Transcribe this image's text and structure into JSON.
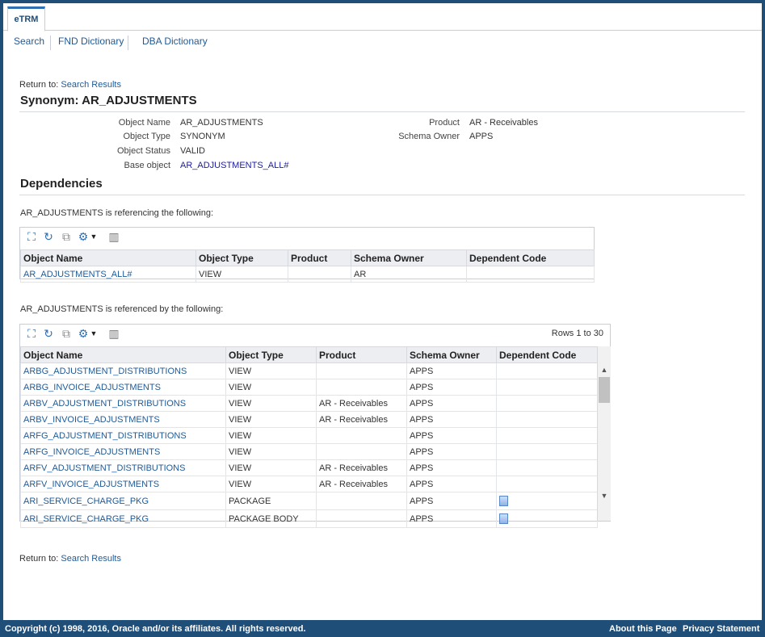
{
  "tabs": [
    {
      "label": "eTRM"
    }
  ],
  "subnav": [
    {
      "label": "Search"
    },
    {
      "label": "FND Dictionary"
    },
    {
      "label": "DBA Dictionary"
    }
  ],
  "return_to": {
    "prefix": "Return to:",
    "link": "Search Results"
  },
  "page_title": "Synonym: AR_ADJUSTMENTS",
  "details": {
    "object_name": {
      "label": "Object Name",
      "value": "AR_ADJUSTMENTS"
    },
    "object_type": {
      "label": "Object Type",
      "value": "SYNONYM"
    },
    "object_status": {
      "label": "Object Status",
      "value": "VALID"
    },
    "base_object": {
      "label": "Base object",
      "value": "AR_ADJUSTMENTS_ALL#"
    },
    "product": {
      "label": "Product",
      "value": "AR - Receivables"
    },
    "schema_owner": {
      "label": "Schema Owner",
      "value": "APPS"
    }
  },
  "dependencies_heading": "Dependencies",
  "referencing": {
    "caption": "AR_ADJUSTMENTS is referencing the following:",
    "columns": [
      "Object Name",
      "Object Type",
      "Product",
      "Schema Owner",
      "Dependent Code"
    ],
    "rows": [
      {
        "name": "AR_ADJUSTMENTS_ALL#",
        "type": "VIEW",
        "product": "",
        "owner": "AR"
      }
    ]
  },
  "referenced_by": {
    "caption": "AR_ADJUSTMENTS is referenced by the following:",
    "rows_label": "Rows 1 to 30",
    "columns": [
      "Object Name",
      "Object Type",
      "Product",
      "Schema Owner",
      "Dependent Code"
    ],
    "rows": [
      {
        "name": "ARBG_ADJUSTMENT_DISTRIBUTIONS",
        "type": "VIEW",
        "product": "",
        "owner": "APPS",
        "code": false
      },
      {
        "name": "ARBG_INVOICE_ADJUSTMENTS",
        "type": "VIEW",
        "product": "",
        "owner": "APPS",
        "code": false
      },
      {
        "name": "ARBV_ADJUSTMENT_DISTRIBUTIONS",
        "type": "VIEW",
        "product": "AR - Receivables",
        "owner": "APPS",
        "code": false
      },
      {
        "name": "ARBV_INVOICE_ADJUSTMENTS",
        "type": "VIEW",
        "product": "AR - Receivables",
        "owner": "APPS",
        "code": false
      },
      {
        "name": "ARFG_ADJUSTMENT_DISTRIBUTIONS",
        "type": "VIEW",
        "product": "",
        "owner": "APPS",
        "code": false
      },
      {
        "name": "ARFG_INVOICE_ADJUSTMENTS",
        "type": "VIEW",
        "product": "",
        "owner": "APPS",
        "code": false
      },
      {
        "name": "ARFV_ADJUSTMENT_DISTRIBUTIONS",
        "type": "VIEW",
        "product": "AR - Receivables",
        "owner": "APPS",
        "code": false
      },
      {
        "name": "ARFV_INVOICE_ADJUSTMENTS",
        "type": "VIEW",
        "product": "AR - Receivables",
        "owner": "APPS",
        "code": false
      },
      {
        "name": "ARI_SERVICE_CHARGE_PKG",
        "type": "PACKAGE",
        "product": "",
        "owner": "APPS",
        "code": true
      },
      {
        "name": "ARI_SERVICE_CHARGE_PKG",
        "type": "PACKAGE BODY",
        "product": "",
        "owner": "APPS",
        "code": true
      }
    ]
  },
  "footer": {
    "copyright": "Copyright (c) 1998, 2016, Oracle and/or its affiliates. All rights reserved.",
    "about": "About this Page",
    "privacy": "Privacy Statement"
  }
}
